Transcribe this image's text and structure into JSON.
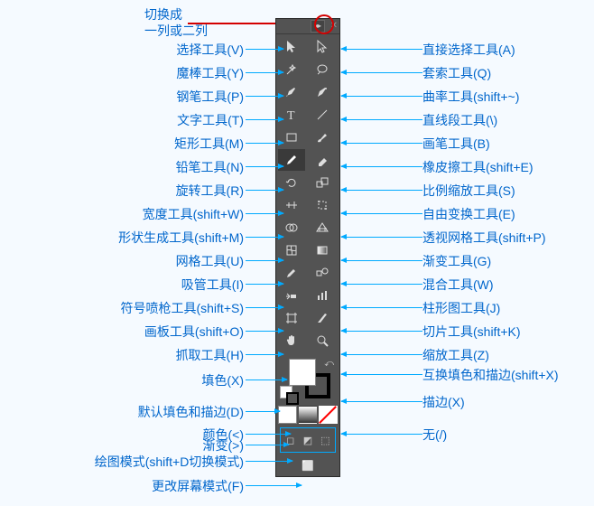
{
  "header": {
    "toggle_title": "切换成",
    "toggle_subtitle": "一列或二列"
  },
  "tools": {
    "left": [
      {
        "label": "选择工具(V)",
        "name": "selection-tool"
      },
      {
        "label": "魔棒工具(Y)",
        "name": "magic-wand-tool"
      },
      {
        "label": "钢笔工具(P)",
        "name": "pen-tool"
      },
      {
        "label": "文字工具(T)",
        "name": "type-tool"
      },
      {
        "label": "矩形工具(M)",
        "name": "rectangle-tool"
      },
      {
        "label": "铅笔工具(N)",
        "name": "pencil-tool"
      },
      {
        "label": "旋转工具(R)",
        "name": "rotate-tool"
      },
      {
        "label": "宽度工具(shift+W)",
        "name": "width-tool"
      },
      {
        "label": "形状生成工具(shift+M)",
        "name": "shape-builder-tool"
      },
      {
        "label": "网格工具(U)",
        "name": "mesh-tool"
      },
      {
        "label": "吸管工具(I)",
        "name": "eyedropper-tool"
      },
      {
        "label": "符号喷枪工具(shift+S)",
        "name": "symbol-sprayer-tool"
      },
      {
        "label": "画板工具(shift+O)",
        "name": "artboard-tool"
      },
      {
        "label": "抓取工具(H)",
        "name": "hand-tool"
      },
      {
        "label": "填色(X)",
        "name": "fill-swatch"
      },
      {
        "label": "默认填色和描边(D)",
        "name": "default-fill-stroke"
      },
      {
        "label": "颜色(<)",
        "name": "color-mode"
      },
      {
        "label": "渐变(>)",
        "name": "gradient-mode"
      },
      {
        "label": "绘图模式(shift+D切换模式)",
        "name": "draw-mode"
      },
      {
        "label": "更改屏幕模式(F)",
        "name": "screen-mode"
      }
    ],
    "right": [
      {
        "label": "直接选择工具(A)",
        "name": "direct-selection-tool"
      },
      {
        "label": "套索工具(Q)",
        "name": "lasso-tool"
      },
      {
        "label": "曲率工具(shift+~)",
        "name": "curvature-tool"
      },
      {
        "label": "直线段工具(\\)",
        "name": "line-tool"
      },
      {
        "label": "画笔工具(B)",
        "name": "brush-tool"
      },
      {
        "label": "橡皮擦工具(shift+E)",
        "name": "eraser-tool"
      },
      {
        "label": "比例缩放工具(S)",
        "name": "scale-tool"
      },
      {
        "label": "自由变换工具(E)",
        "name": "free-transform-tool"
      },
      {
        "label": "透视网格工具(shift+P)",
        "name": "perspective-grid-tool"
      },
      {
        "label": "渐变工具(G)",
        "name": "gradient-tool"
      },
      {
        "label": "混合工具(W)",
        "name": "blend-tool"
      },
      {
        "label": "柱形图工具(J)",
        "name": "column-graph-tool"
      },
      {
        "label": "切片工具(shift+K)",
        "name": "slice-tool"
      },
      {
        "label": "缩放工具(Z)",
        "name": "zoom-tool"
      },
      {
        "label": "互换填色和描边(shift+X)",
        "name": "swap-fill-stroke"
      },
      {
        "label": "描边(X)",
        "name": "stroke-swatch"
      },
      {
        "label": "无(/)",
        "name": "none-mode"
      }
    ]
  }
}
